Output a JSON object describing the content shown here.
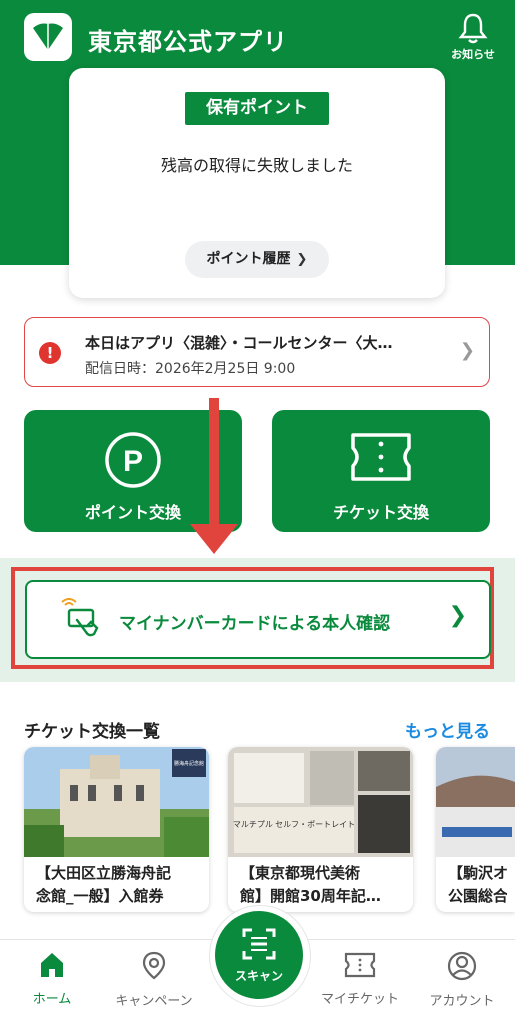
{
  "header": {
    "app_title": "東京都公式アプリ",
    "notifications_label": "お知らせ"
  },
  "points": {
    "badge": "保有ポイント",
    "error_message": "残高の取得に失敗しました",
    "history_label": "ポイント履歴"
  },
  "notice": {
    "title": "本日はアプリ〈混雑〉・コールセンター〈大…",
    "date": "配信日時：2026年2月25日 9:00",
    "icon": "!"
  },
  "tiles": {
    "points_exchange": "ポイント交換",
    "ticket_exchange": "チケット交換",
    "points_icon_letter": "P"
  },
  "mynumber": {
    "label": "マイナンバーカードによる本人確認"
  },
  "tickets": {
    "title": "チケット交換一覧",
    "more": "もっと見る",
    "cards": [
      {
        "line1": "【大田区立勝海舟記",
        "line2": "念館_一般】入館券",
        "sign_text": "勝海舟記念館"
      },
      {
        "line1": "【東京都現代美術",
        "line2": "館】開館30周年記…",
        "poster_text": "マルチプル セルフ・ポートレイト"
      },
      {
        "line1": "【駒沢オ",
        "line2": "公園総合"
      }
    ]
  },
  "nav": {
    "home": "ホーム",
    "campaign": "キャンペーン",
    "scan": "スキャン",
    "my_ticket": "マイチケット",
    "account": "アカウント"
  },
  "colors": {
    "brand_green": "#0a8a3c",
    "alert_red": "#e0443c",
    "link_blue": "#1b8be0"
  }
}
